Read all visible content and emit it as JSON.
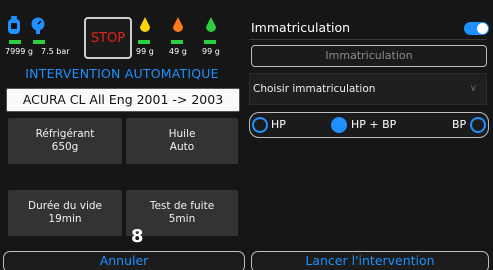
{
  "status": {
    "vacuum_value": "7999 g",
    "pressure_value": "7.5 bar",
    "oil_1": "99 g",
    "oil_2": "49 g",
    "oil_3": "99 g"
  },
  "stop_label": "STOP",
  "mode_title": "INTERVENTION AUTOMATIQUE",
  "vehicle": "ACURA CL All Eng 2001 -> 2003",
  "tiles": {
    "refrigerant_label": "Réfrigérant",
    "refrigerant_value": "650g",
    "oil_label": "Huile",
    "oil_value": "Auto",
    "vacuum_label": "Durée du vide",
    "vacuum_value": "19min",
    "leak_label": "Test de fuite",
    "leak_value": "5min"
  },
  "counter": "8",
  "buttons": {
    "cancel": "Annuler",
    "start": "Lancer l'intervention"
  },
  "right": {
    "title": "Immatriculation",
    "toggle_on": true,
    "plate_placeholder": "Immatriculation",
    "select_label": "Choisir immatriculation",
    "radio_hp": "HP",
    "radio_hpbp": "HP + BP",
    "radio_bp": "BP",
    "selected_radio": "HP + BP"
  },
  "colors": {
    "accent": "#1e90ff",
    "stop": "#e3221b",
    "level_bar": "#2ecc40",
    "oil_yellow": "#ffd400",
    "oil_orange": "#ff7a1a",
    "oil_green": "#2ecc40",
    "tank_blue": "#1e90ff"
  },
  "icons": [
    "gas-cylinder-icon",
    "pressure-gauge-icon",
    "oil-drop-icon",
    "oil-drop-icon",
    "oil-drop-icon",
    "chevron-down-icon"
  ]
}
